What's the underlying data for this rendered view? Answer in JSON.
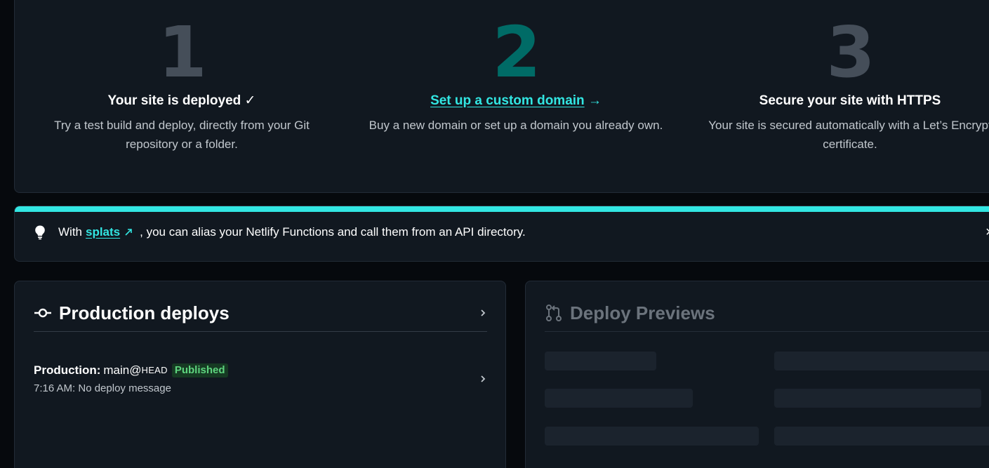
{
  "steps": [
    {
      "number": "1",
      "title": "Your site is deployed ✓",
      "description": "Try a test build and deploy, directly from your Git repository or a folder."
    },
    {
      "number": "2",
      "title_link": "Set up a custom domain",
      "title_arrow": "→",
      "description": "Buy a new domain or set up a domain you already own."
    },
    {
      "number": "3",
      "title": "Secure your site with HTTPS",
      "description": "Your site is secured automatically with a Let’s Encrypt certificate."
    }
  ],
  "tip": {
    "prefix": "With",
    "link": "splats",
    "link_icon": "external-link-icon",
    "suffix": ", you can alias your Netlify Functions and call them from an API directory.",
    "close": "×",
    "icon": "lightbulb-icon",
    "accent": "#32e6e2"
  },
  "production": {
    "title": "Production deploys",
    "icon": "commit-icon",
    "deploy": {
      "label": "Production:",
      "branch": "main@",
      "ref": "HEAD",
      "status": "Published",
      "time": "7:16 AM:",
      "message": "No deploy message"
    }
  },
  "previews": {
    "title": "Deploy Previews",
    "icon": "pull-request-icon"
  },
  "colors": {
    "background": "#06090d",
    "card": "#111820",
    "accent": "#32e6e2",
    "step_active": "#006b66",
    "step_muted": "#454e59",
    "published_bg": "#163a23",
    "published_fg": "#5ed47e"
  }
}
